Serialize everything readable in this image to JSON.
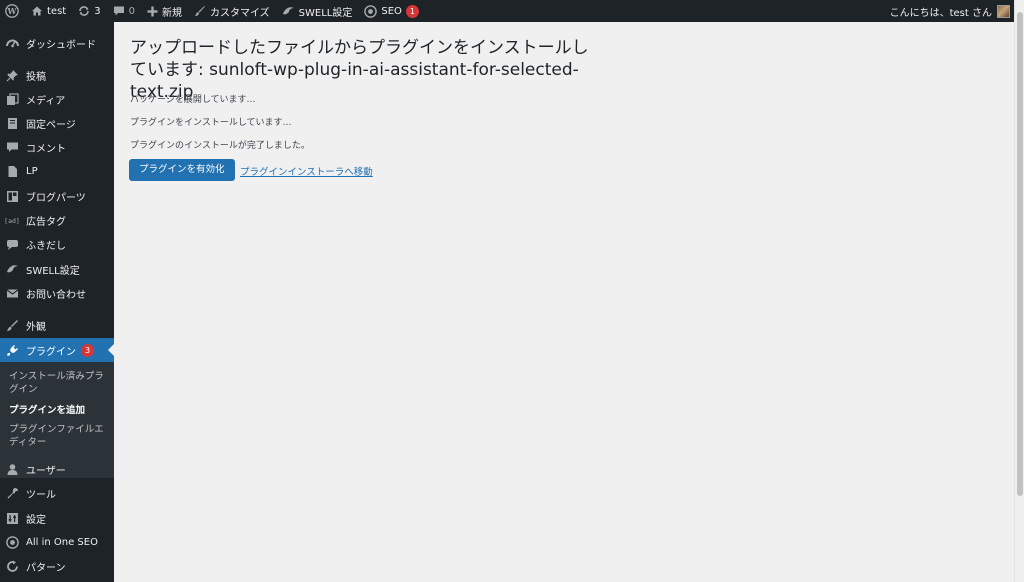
{
  "adminbar": {
    "site_name": "test",
    "updates_count": "3",
    "comments_count": "0",
    "new_label": "新規",
    "customize_label": "カスタマイズ",
    "swell_label": "SWELL設定",
    "seo_label": "SEO",
    "seo_badge": "1",
    "greeting": "こんにちは、test さん"
  },
  "sidebar": {
    "items": [
      {
        "label": "ダッシュボード",
        "icon": "dashboard-icon"
      },
      {
        "label": "投稿",
        "icon": "pin-icon"
      },
      {
        "label": "メディア",
        "icon": "media-icon"
      },
      {
        "label": "固定ページ",
        "icon": "page-icon"
      },
      {
        "label": "コメント",
        "icon": "comment-icon"
      },
      {
        "label": "LP",
        "icon": "lp-icon"
      },
      {
        "label": "ブログパーツ",
        "icon": "blog-parts-icon"
      },
      {
        "label": "広告タグ",
        "icon": "ad-tag-icon"
      },
      {
        "label": "ふきだし",
        "icon": "balloon-icon"
      },
      {
        "label": "SWELL設定",
        "icon": "swell-icon"
      },
      {
        "label": "お問い合わせ",
        "icon": "mail-icon"
      },
      {
        "label": "外観",
        "icon": "brush-icon"
      },
      {
        "label": "プラグイン",
        "icon": "plugin-icon",
        "badge": "3"
      },
      {
        "label": "ユーザー",
        "icon": "user-icon"
      },
      {
        "label": "ツール",
        "icon": "wrench-icon"
      },
      {
        "label": "設定",
        "icon": "settings-icon"
      },
      {
        "label": "All in One SEO",
        "icon": "aioseo-icon"
      },
      {
        "label": "パターン",
        "icon": "pattern-icon"
      }
    ],
    "submenu": [
      "インストール済みプラグイン",
      "プラグインを追加",
      "プラグインファイルエディター"
    ]
  },
  "main": {
    "title": "アップロードしたファイルからプラグインをインストールしています: sunloft-wp-plug-in-ai-assistant-for-selected-text.zip",
    "log": [
      "パッケージを展開しています…",
      "プラグインをインストールしています…",
      "プラグインのインストールが完了しました。"
    ],
    "activate_button": "プラグインを有効化",
    "installer_link": "プラグインインストーラへ移動"
  },
  "colors": {
    "adminbar_bg": "#1d2327",
    "sidebar_bg": "#1d2327",
    "accent": "#2271b1",
    "badge": "#d63638",
    "content_bg": "#f0f0f1"
  }
}
